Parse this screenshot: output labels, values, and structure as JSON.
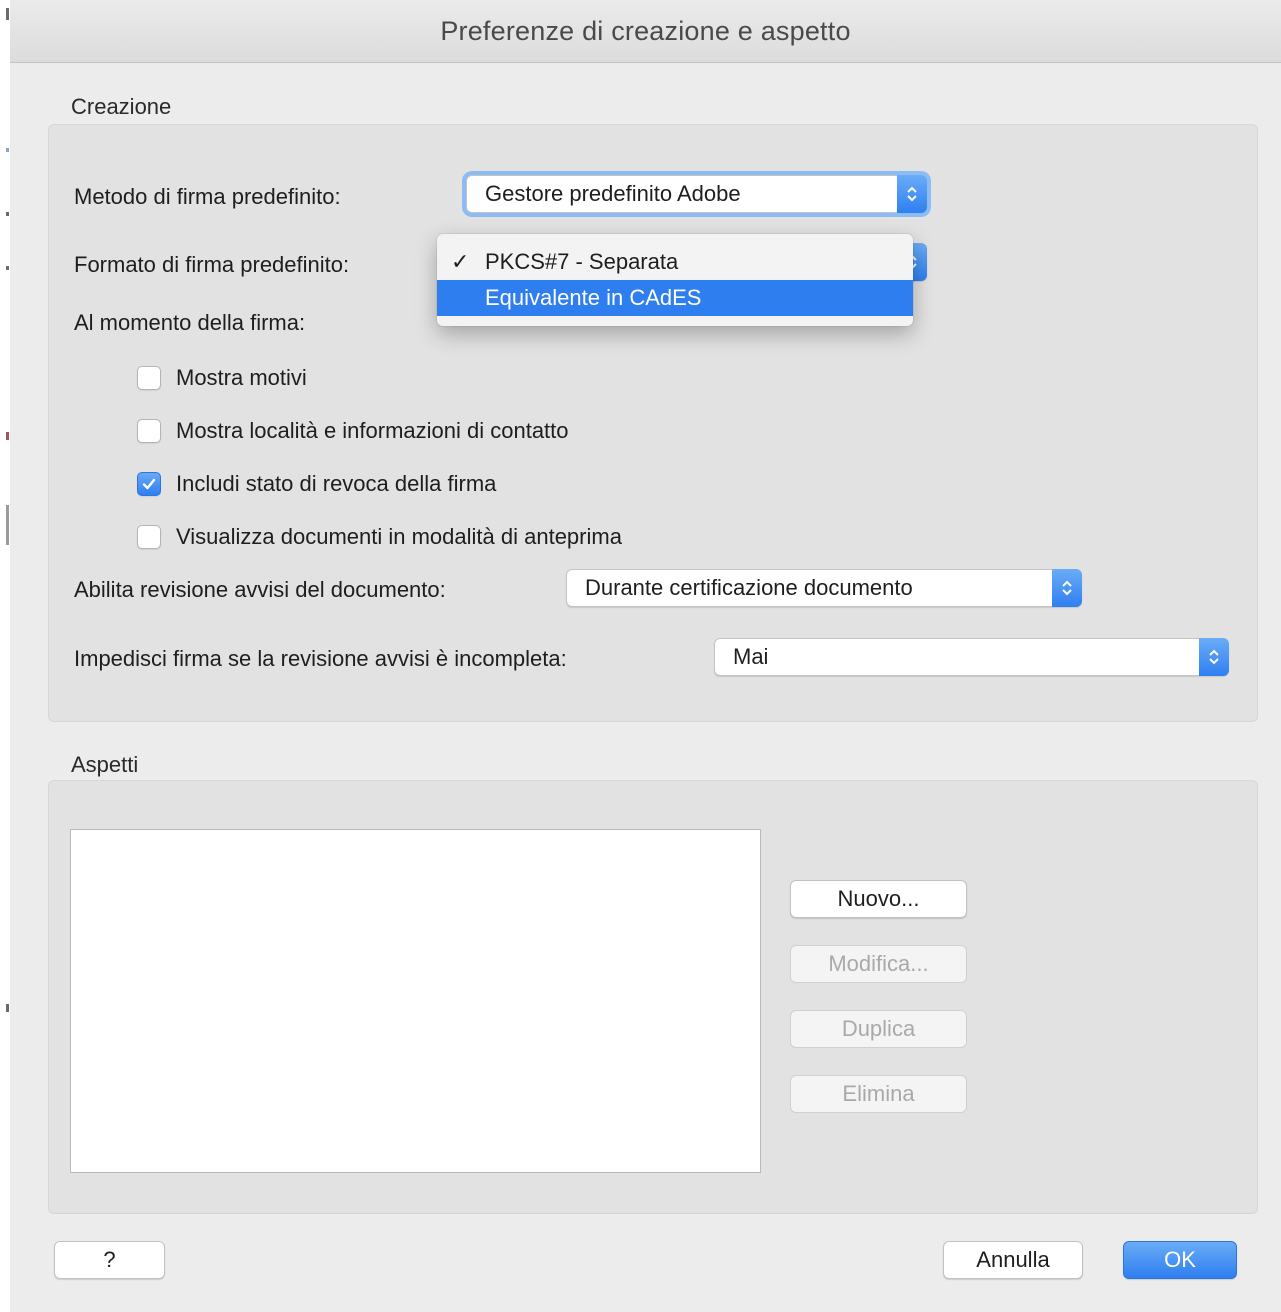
{
  "window": {
    "title": "Preferenze di creazione e aspetto"
  },
  "creation": {
    "section_label": "Creazione",
    "default_method": {
      "label": "Metodo di firma predefinito:",
      "value": "Gestore predefinito Adobe"
    },
    "default_format": {
      "label": "Formato di firma predefinito:",
      "menu_options": [
        {
          "label": "PKCS#7 - Separata",
          "checked": true,
          "check_glyph": "✓"
        },
        {
          "label": "Equivalente in CAdES",
          "highlighted": true
        }
      ]
    },
    "on_sign": {
      "label": "Al momento della firma:",
      "options": [
        {
          "label": "Mostra motivi",
          "checked": false
        },
        {
          "label": "Mostra località e informazioni di contatto",
          "checked": false
        },
        {
          "label": "Includi stato di revoca della firma",
          "checked": true
        },
        {
          "label": "Visualizza documenti in modalità di anteprima",
          "checked": false
        }
      ]
    },
    "enable_review": {
      "label": "Abilita revisione avvisi del documento:",
      "value": "Durante certificazione documento"
    },
    "prevent_sign": {
      "label": "Impedisci firma se la revisione avvisi è incompleta:",
      "value": "Mai"
    }
  },
  "appearances": {
    "section_label": "Aspetti",
    "items": [],
    "buttons": {
      "new": "Nuovo...",
      "edit": "Modifica...",
      "duplicate": "Duplica",
      "delete": "Elimina"
    }
  },
  "footer": {
    "help": "?",
    "cancel": "Annulla",
    "ok": "OK"
  },
  "colors": {
    "accent": "#2e7ef0",
    "window_bg": "#ececec",
    "group_bg": "#e2e2e2"
  }
}
